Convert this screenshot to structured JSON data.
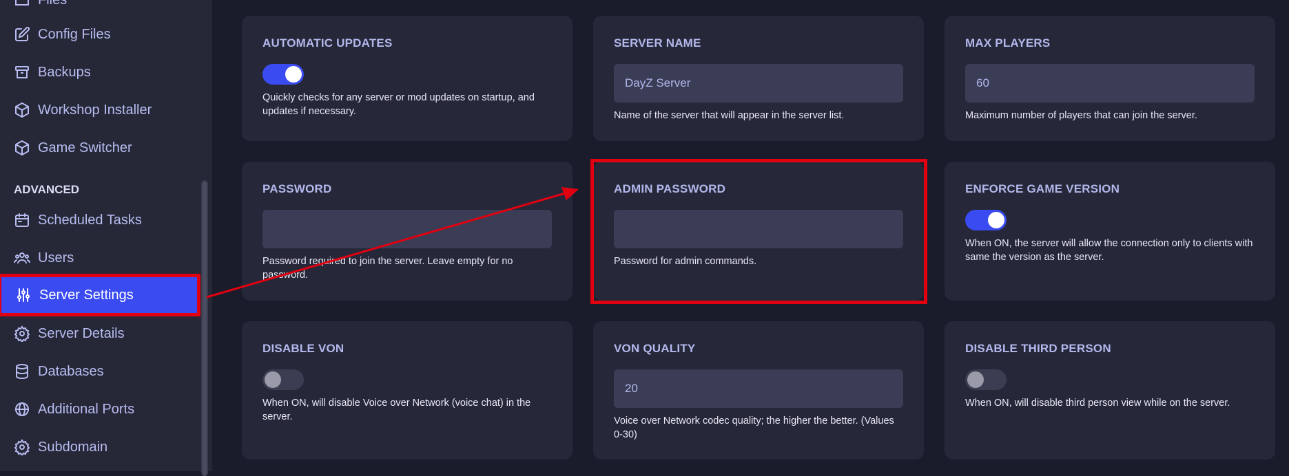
{
  "sidebar": {
    "section_label": "ADVANCED",
    "items": [
      {
        "label": "Files",
        "icon": "folder-icon"
      },
      {
        "label": "Config Files",
        "icon": "edit-icon"
      },
      {
        "label": "Backups",
        "icon": "archive-icon"
      },
      {
        "label": "Workshop Installer",
        "icon": "cube-icon"
      },
      {
        "label": "Game Switcher",
        "icon": "cube-icon"
      },
      {
        "label": "Scheduled Tasks",
        "icon": "calendar-icon"
      },
      {
        "label": "Users",
        "icon": "users-icon"
      },
      {
        "label": "Server Settings",
        "icon": "sliders-icon",
        "active": true
      },
      {
        "label": "Server Details",
        "icon": "gear-icon"
      },
      {
        "label": "Databases",
        "icon": "database-icon"
      },
      {
        "label": "Additional Ports",
        "icon": "globe-icon"
      },
      {
        "label": "Subdomain",
        "icon": "gear-icon"
      }
    ]
  },
  "settings": {
    "automatic_updates": {
      "title": "AUTOMATIC UPDATES",
      "enabled": true,
      "description": "Quickly checks for any server or mod updates on startup, and updates if necessary."
    },
    "server_name": {
      "title": "SERVER NAME",
      "value": "DayZ Server",
      "description": "Name of the server that will appear in the server list."
    },
    "max_players": {
      "title": "MAX PLAYERS",
      "value": "60",
      "description": "Maximum number of players that can join the server."
    },
    "password": {
      "title": "PASSWORD",
      "value": "",
      "description": "Password required to join the server. Leave empty for no password."
    },
    "admin_password": {
      "title": "ADMIN PASSWORD",
      "value": "",
      "description": "Password for admin commands."
    },
    "enforce_game_version": {
      "title": "ENFORCE GAME VERSION",
      "enabled": true,
      "description": "When ON, the server will allow the connection only to clients with same the version as the server."
    },
    "disable_von": {
      "title": "DISABLE VON",
      "enabled": false,
      "description": "When ON, will disable Voice over Network (voice chat) in the server."
    },
    "von_quality": {
      "title": "VON QUALITY",
      "value": "20",
      "description": "Voice over Network codec quality; the higher the better. (Values 0-30)"
    },
    "disable_third_person": {
      "title": "DISABLE THIRD PERSON",
      "enabled": false,
      "description": "When ON, will disable third person view while on the server."
    }
  },
  "colors": {
    "accent": "#3a4bf2",
    "annotation_red": "#e0000f",
    "background": "#1b1c2b",
    "card": "#262839"
  }
}
